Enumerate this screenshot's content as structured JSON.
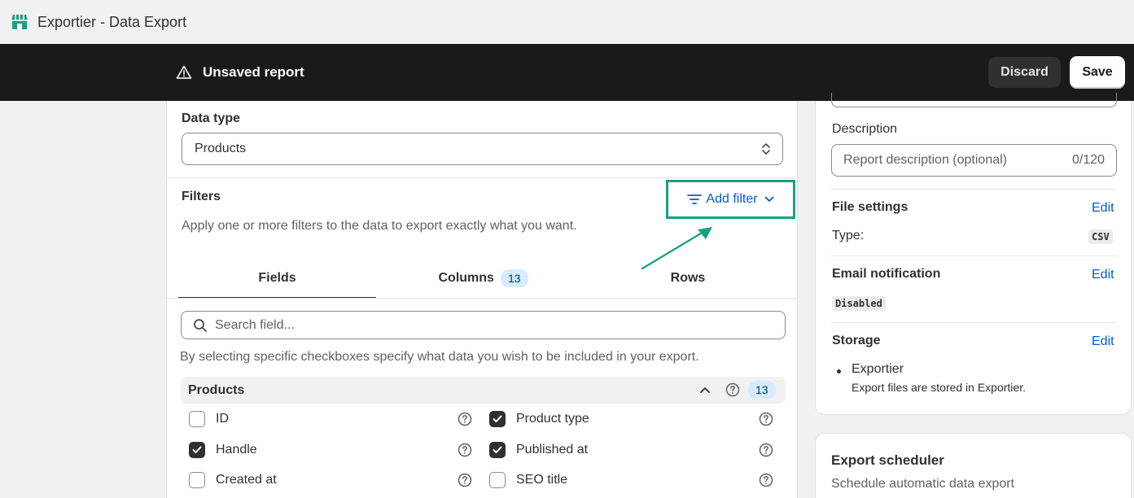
{
  "window": {
    "title": "Exportier - Data Export"
  },
  "context_bar": {
    "title": "Unsaved report",
    "discard_label": "Discard",
    "save_label": "Save"
  },
  "main": {
    "data_type": {
      "label": "Data type",
      "value": "Products"
    },
    "filters": {
      "label": "Filters",
      "description": "Apply one or more filters to the data to export exactly what you want.",
      "add_filter_label": "Add filter"
    },
    "tabs": [
      {
        "label": "Fields",
        "active": true
      },
      {
        "label": "Columns",
        "badge": "13"
      },
      {
        "label": "Rows"
      }
    ],
    "search": {
      "placeholder": "Search field..."
    },
    "help_text": "By selecting specific checkboxes specify what data you wish to be included in your export.",
    "group": {
      "title": "Products",
      "count": "13",
      "fields": [
        {
          "label": "ID",
          "checked": false
        },
        {
          "label": "Product type",
          "checked": true
        },
        {
          "label": "Handle",
          "checked": true
        },
        {
          "label": "Published at",
          "checked": true
        },
        {
          "label": "Created at",
          "checked": false
        },
        {
          "label": "SEO title",
          "checked": false
        }
      ]
    }
  },
  "sidebar": {
    "description": {
      "label": "Description",
      "placeholder": "Report description (optional)",
      "counter": "0/120"
    },
    "file_settings": {
      "title": "File settings",
      "edit_label": "Edit",
      "type_label": "Type:",
      "type_value": "CSV"
    },
    "email_notification": {
      "title": "Email notification",
      "edit_label": "Edit",
      "status": "Disabled"
    },
    "storage": {
      "title": "Storage",
      "edit_label": "Edit",
      "item_name": "Exportier",
      "item_desc": "Export files are stored in Exportier."
    },
    "scheduler": {
      "title": "Export scheduler",
      "description": "Schedule automatic data export"
    }
  },
  "colors": {
    "accent_link": "#005bd3",
    "annotation": "#1aa080",
    "context_bar": "#1a1a1a"
  }
}
